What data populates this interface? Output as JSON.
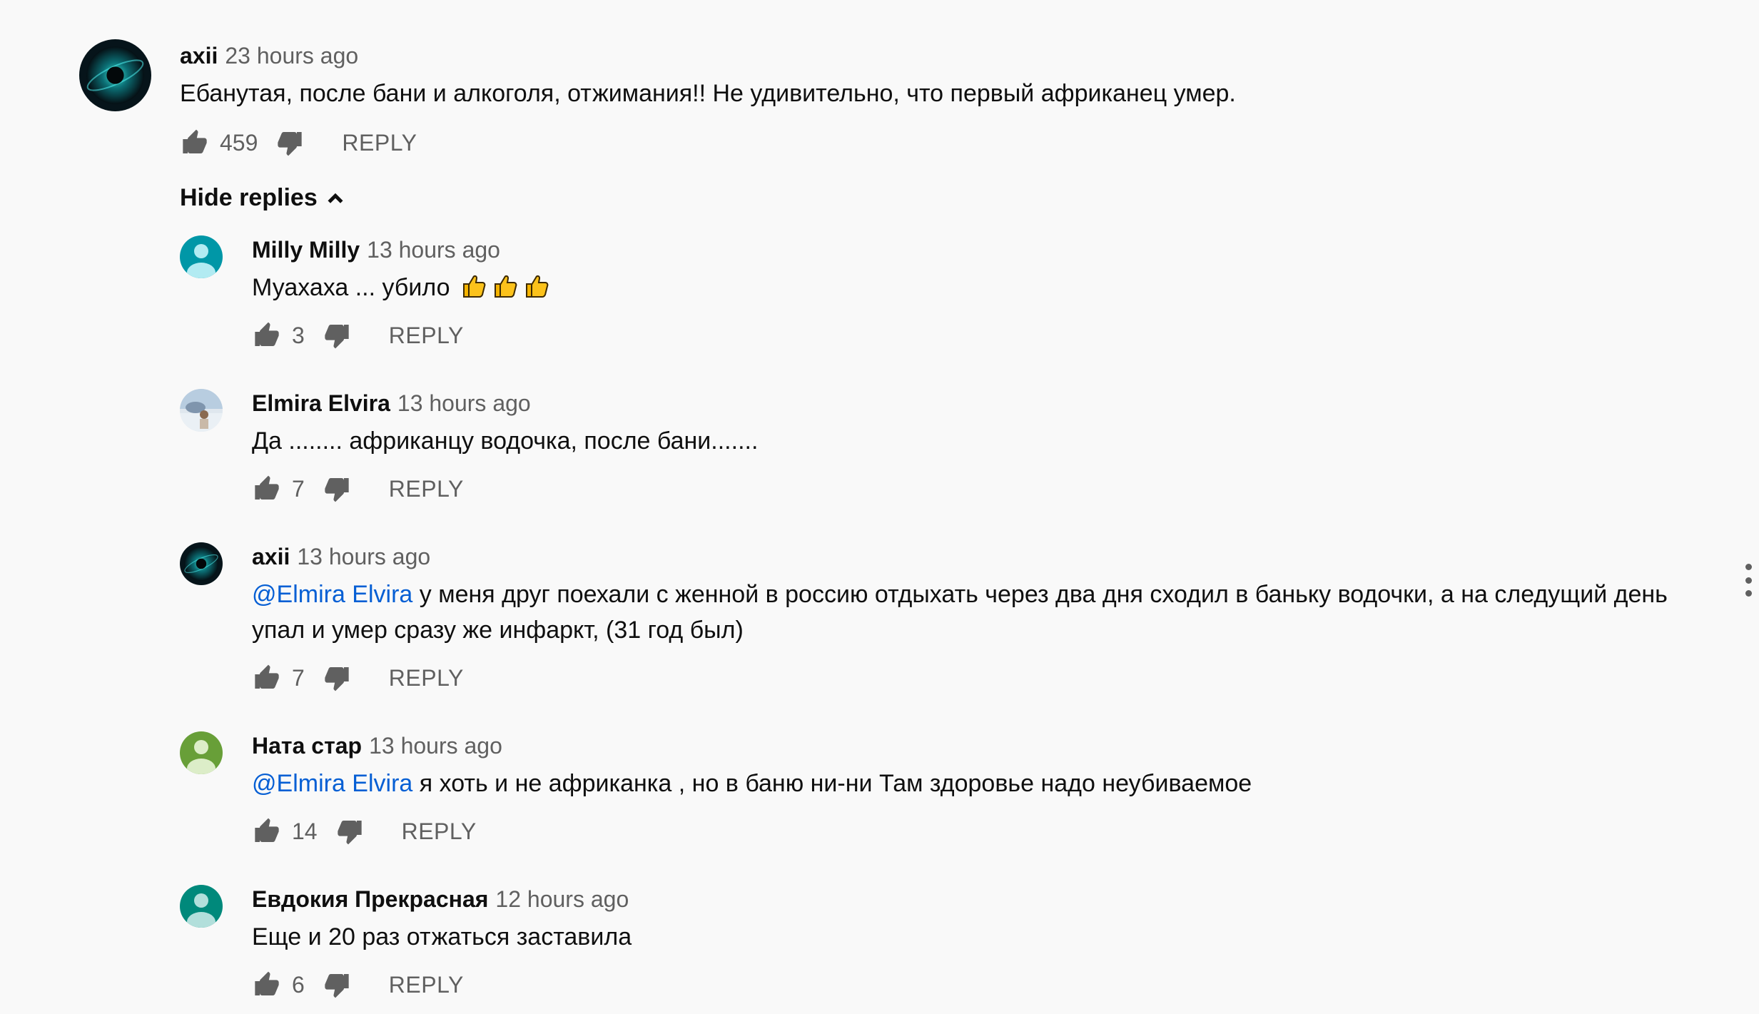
{
  "top_comment": {
    "author": "axii",
    "time": "23 hours ago",
    "text": "Ебанутая, после бани и алкоголя, отжимания!!  Не удивительно, что первый африканец умер.",
    "likes": "459",
    "reply_label": "REPLY"
  },
  "hide_replies_label": "Hide replies",
  "replies": [
    {
      "author": "Milly Milly",
      "time": "13 hours ago",
      "mention": "",
      "text": "Муахаха ... убило",
      "likes": "3",
      "reply_label": "REPLY",
      "avatar_color": "#00838f"
    },
    {
      "author": "Elmira Elvira",
      "time": "13 hours ago",
      "mention": "",
      "text": "Да ........ африканцу водочка, после бани.......",
      "likes": "7",
      "reply_label": "REPLY"
    },
    {
      "author": "axii",
      "time": "13 hours ago",
      "mention": "@Elmira Elvira",
      "text": " у меня друг поехали с женной в россию отдыхать через два дня сходил в баньку водочки, а на следущий день упал и умер сразу же инфаркт, (31 год был)",
      "likes": "7",
      "reply_label": "REPLY"
    },
    {
      "author": "Ната стар",
      "time": "13 hours ago",
      "mention": "@Elmira Elvira",
      "text": " я хоть и не африканка , но в баню ни-ни Там  здоровье надо неубиваемое",
      "likes": "14",
      "reply_label": "REPLY",
      "avatar_color": "#689f38"
    },
    {
      "author": "Евдокия Прекрасная",
      "time": "12 hours ago",
      "mention": "",
      "text": "Еще и 20 раз отжаться заставила",
      "likes": "6",
      "reply_label": "REPLY",
      "avatar_color": "#00796b"
    }
  ],
  "icons": {
    "like": "thumb-up-icon",
    "dislike": "thumb-down-icon",
    "collapse": "chevron-up-icon",
    "menu": "more-vertical-icon"
  }
}
